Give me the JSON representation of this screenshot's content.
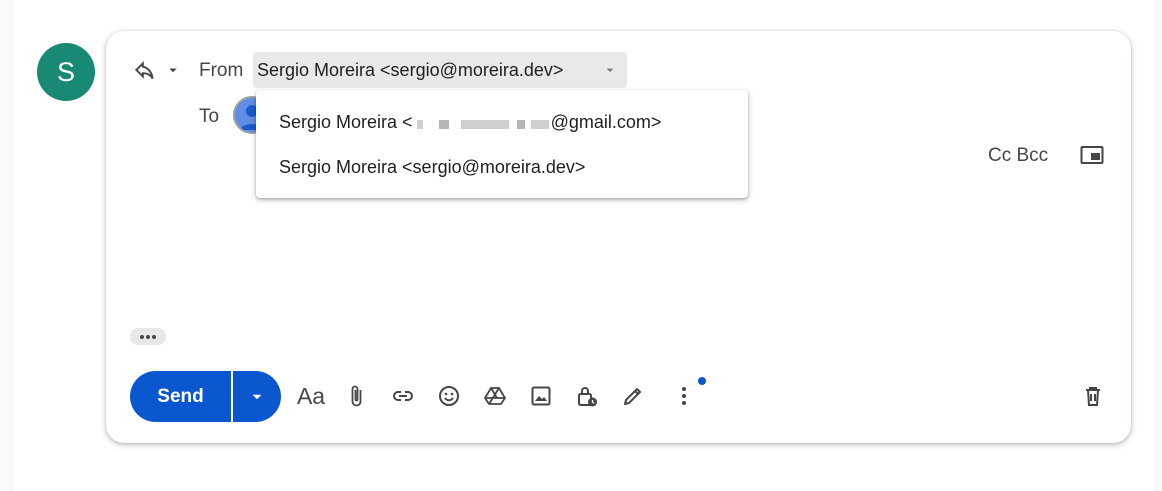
{
  "sender_avatar": {
    "letter": "S",
    "color": "#188a73"
  },
  "header": {
    "from_label": "From",
    "from_value": "Sergio Moreira <sergio@moreira.dev>",
    "to_label": "To",
    "cc_bcc": "Cc Bcc"
  },
  "from_dropdown": {
    "options": [
      {
        "name_prefix": "Sergio Moreira <",
        "redacted": true,
        "suffix": "@gmail.com>"
      },
      {
        "label": "Sergio Moreira <sergio@moreira.dev>"
      }
    ]
  },
  "toolbar": {
    "send_label": "Send",
    "format_label": "Aa",
    "icons": [
      "formatting-options",
      "attach-icon",
      "link-icon",
      "emoji-icon",
      "drive-icon",
      "photo-icon",
      "confidential-icon",
      "signature-icon",
      "more-options-icon",
      "delete-icon"
    ]
  },
  "colors": {
    "accent": "#0b57d0",
    "avatar": "#188a73"
  }
}
